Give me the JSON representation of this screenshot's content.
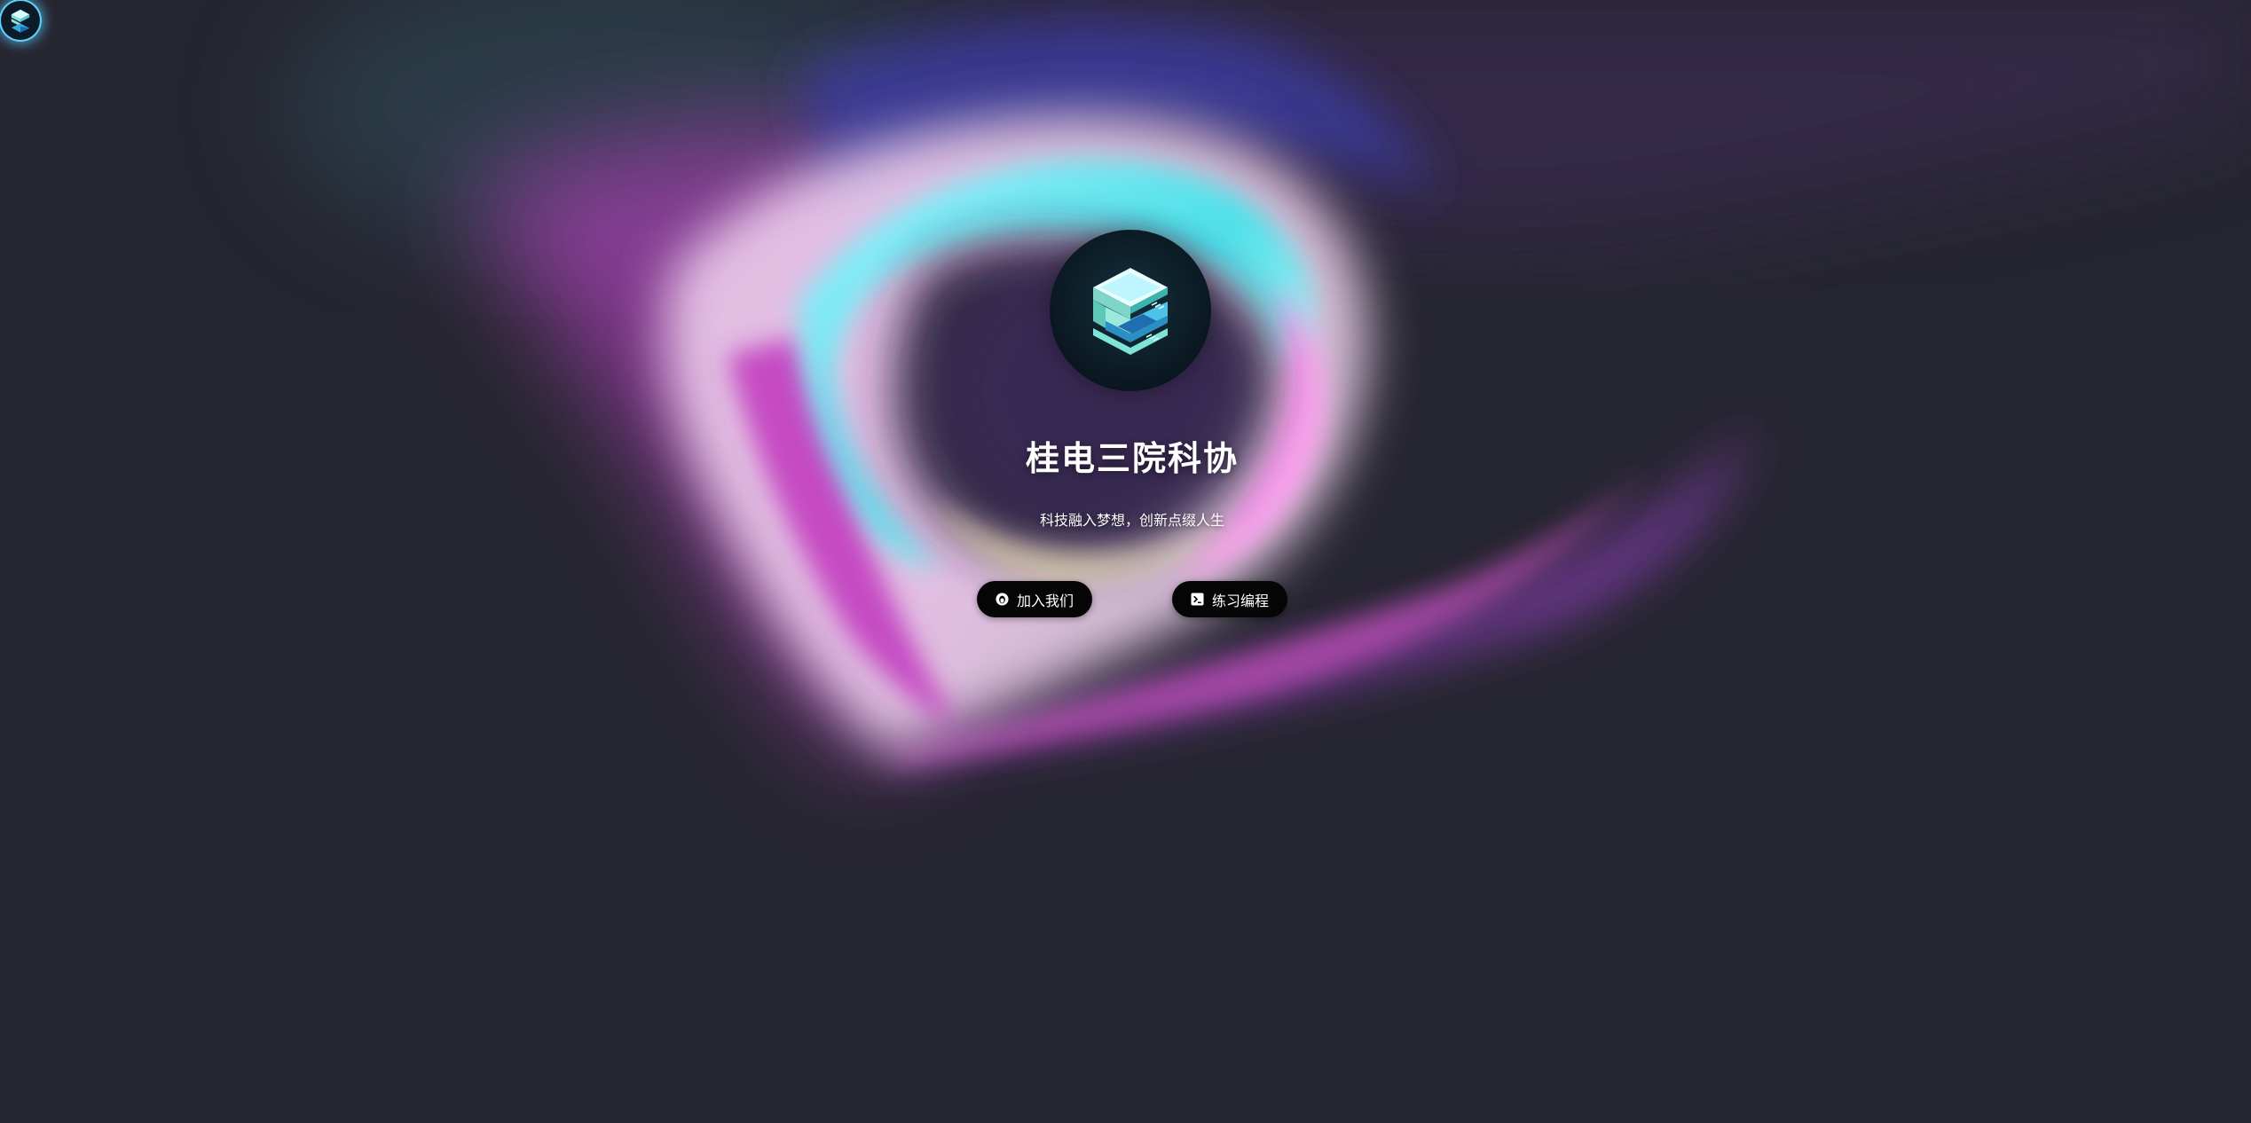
{
  "hero": {
    "title": "桂电三院科协",
    "subtitle": "科技融入梦想，创新点缀人生",
    "logo_icon": "circuit-s-logo-icon"
  },
  "corner": {
    "logo_icon": "circuit-s-logo-icon"
  },
  "actions": {
    "join_label": "加入我们",
    "join_icon": "qq-penguin-icon",
    "code_label": "练习编程",
    "code_icon": "terminal-icon"
  },
  "colors": {
    "background": "#262630",
    "accent_cyan": "#5fe6f0",
    "accent_magenta": "#c43fc4",
    "button_bg": "#050505"
  }
}
